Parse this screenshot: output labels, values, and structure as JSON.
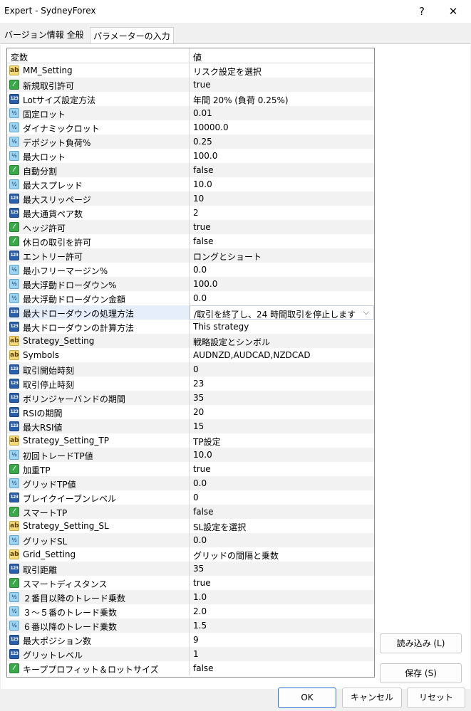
{
  "window": {
    "title": "Expert - SydneyForex",
    "help_label": "?",
    "close_label": "✕"
  },
  "tabs": [
    {
      "label": "バージョン情報  全般"
    },
    {
      "label": "パラメーターの入力"
    }
  ],
  "grid": {
    "col_variable": "変数",
    "col_value": "値",
    "rows": [
      {
        "type": "ab",
        "name": "MM_Setting",
        "value": "リスク設定を選択"
      },
      {
        "type": "bool",
        "name": "新規取引許可",
        "value": "true"
      },
      {
        "type": "int",
        "name": "Lotサイズ設定方法",
        "value": "年間 20% (負荷 0.25%)"
      },
      {
        "type": "dbl",
        "name": "固定ロット",
        "value": "0.01"
      },
      {
        "type": "dbl",
        "name": "ダイナミックロット",
        "value": "10000.0"
      },
      {
        "type": "dbl",
        "name": "デポジット負荷%",
        "value": "0.25"
      },
      {
        "type": "dbl",
        "name": "最大ロット",
        "value": "100.0"
      },
      {
        "type": "bool",
        "name": "自動分割",
        "value": "false"
      },
      {
        "type": "dbl",
        "name": "最大スプレッド",
        "value": "10.0"
      },
      {
        "type": "int",
        "name": "最大スリッページ",
        "value": "10"
      },
      {
        "type": "int",
        "name": "最大通貨ペア数",
        "value": "2"
      },
      {
        "type": "bool",
        "name": "ヘッジ許可",
        "value": "true"
      },
      {
        "type": "bool",
        "name": "休日の取引を許可",
        "value": "false"
      },
      {
        "type": "int",
        "name": "エントリー許可",
        "value": "ロングとショート"
      },
      {
        "type": "dbl",
        "name": "最小フリーマージン%",
        "value": "0.0"
      },
      {
        "type": "dbl",
        "name": "最大浮動ドローダウン%",
        "value": "100.0"
      },
      {
        "type": "dbl",
        "name": "最大浮動ドローダウン金額",
        "value": "0.0"
      },
      {
        "type": "int",
        "name": "最大ドローダウンの処理方法",
        "value": "/取引を終了し、24 時間取引を停止します",
        "selected": true
      },
      {
        "type": "int",
        "name": "最大ドローダウンの計算方法",
        "value": "This strategy"
      },
      {
        "type": "ab",
        "name": "Strategy_Setting",
        "value": "戦略設定とシンボル"
      },
      {
        "type": "ab",
        "name": "Symbols",
        "value": "AUDNZD,AUDCAD,NZDCAD"
      },
      {
        "type": "int",
        "name": "取引開始時刻",
        "value": "0"
      },
      {
        "type": "int",
        "name": "取引停止時刻",
        "value": "23"
      },
      {
        "type": "int",
        "name": "ボリンジャーバンドの期間",
        "value": "35"
      },
      {
        "type": "int",
        "name": "RSIの期間",
        "value": "20"
      },
      {
        "type": "int",
        "name": "最大RSI値",
        "value": "15"
      },
      {
        "type": "ab",
        "name": "Strategy_Setting_TP",
        "value": "TP設定"
      },
      {
        "type": "dbl",
        "name": "初回トレードTP値",
        "value": "10.0"
      },
      {
        "type": "bool",
        "name": "加重TP",
        "value": "true"
      },
      {
        "type": "dbl",
        "name": "グリッドTP値",
        "value": "0.0"
      },
      {
        "type": "int",
        "name": "ブレイクイーブンレベル",
        "value": "0"
      },
      {
        "type": "bool",
        "name": "スマートTP",
        "value": "false"
      },
      {
        "type": "ab",
        "name": "Strategy_Setting_SL",
        "value": "SL設定を選択"
      },
      {
        "type": "dbl",
        "name": "グリッドSL",
        "value": "0.0"
      },
      {
        "type": "ab",
        "name": "Grid_Setting",
        "value": "グリッドの間隔と乗数"
      },
      {
        "type": "int",
        "name": "取引距離",
        "value": "35"
      },
      {
        "type": "bool",
        "name": "スマートディスタンス",
        "value": "true"
      },
      {
        "type": "dbl",
        "name": "２番目以降のトレード乗数",
        "value": "1.0"
      },
      {
        "type": "dbl",
        "name": "３～５番のトレード乗数",
        "value": "2.0"
      },
      {
        "type": "dbl",
        "name": "６番以降のトレード乗数",
        "value": "1.5"
      },
      {
        "type": "int",
        "name": "最大ポジション数",
        "value": "9"
      },
      {
        "type": "int",
        "name": "グリットレベル",
        "value": "1"
      },
      {
        "type": "bool",
        "name": "キーププロフィット＆ロットサイズ",
        "value": "false"
      }
    ]
  },
  "icon_text": {
    "ab": "ab",
    "bool": "⁄",
    "int": "123",
    "dbl": "½"
  },
  "buttons": {
    "load": "読み込み (L)",
    "save": "保存 (S)",
    "ok": "OK",
    "cancel": "キャンセル",
    "reset": "リセット"
  }
}
